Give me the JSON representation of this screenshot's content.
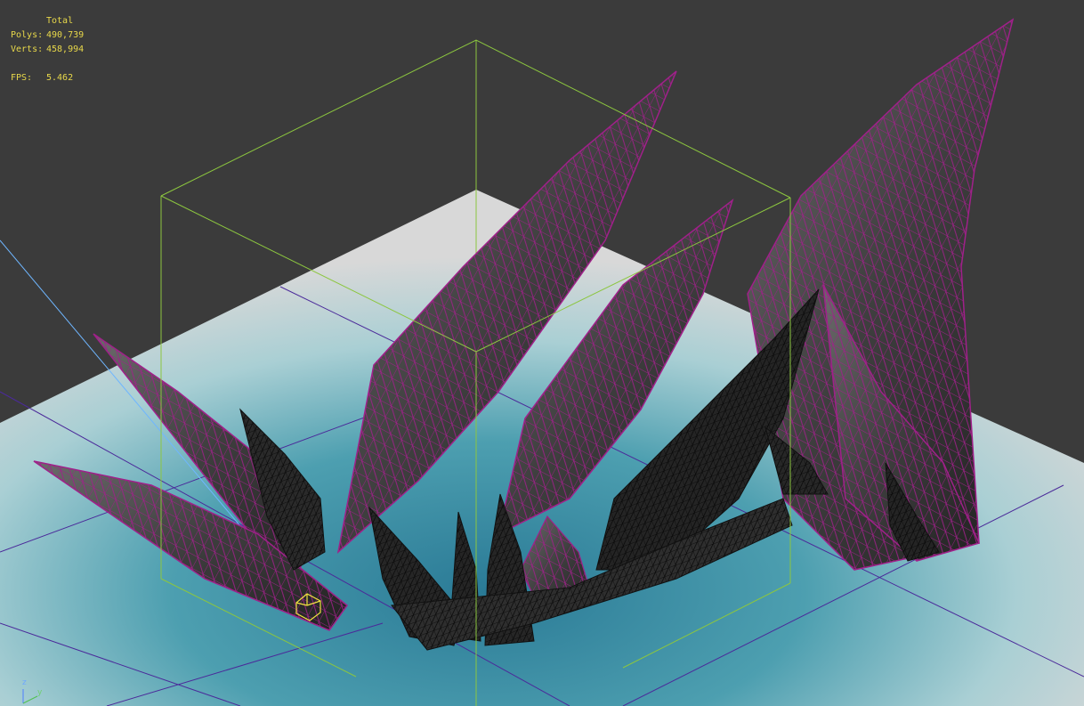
{
  "stats": {
    "header": "Total",
    "polys_label": "Polys:",
    "polys_value": "490,739",
    "verts_label": "Verts:",
    "verts_value": "458,994",
    "fps_label": "FPS:",
    "fps_value": "5.462"
  },
  "axis": {
    "z_label": "z",
    "y_label": "y"
  },
  "colors": {
    "viewport_bg": "#3b3b3b",
    "stats_text": "#e8d84a",
    "wireframe_selected": "#a0208a",
    "bounding_box": "#8cc63f",
    "grid_lines": "#4b2a9a",
    "ground_center": "#2c7f9a",
    "ground_edge": "#d4d4d4",
    "mesh_dark": "#1e1e1e"
  }
}
